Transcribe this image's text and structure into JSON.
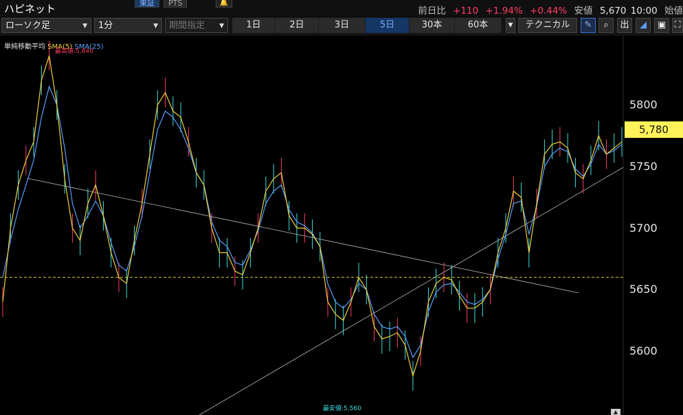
{
  "header": {
    "title": "ハピネット",
    "exchange_tabs": [
      "東証",
      "PTS"
    ],
    "quote": {
      "change_label": "前日比",
      "change": "+110",
      "change_pct": "+1.94%",
      "range_pct": "+0.44%",
      "low_label": "安値",
      "low_value": "5,670",
      "time": "10:00",
      "open_label": "始値"
    }
  },
  "toolbar": {
    "chart_type": "ローソク足",
    "interval": "1分",
    "period_select": "期間指定",
    "ranges": [
      "1日",
      "2日",
      "3日",
      "5日",
      "30本",
      "60本"
    ],
    "active_range": "5日",
    "technical_label": "テクニカル",
    "icons": [
      "pen-icon",
      "zoom-icon",
      "volume-icon",
      "area-chart-icon",
      "save-icon",
      "expand-icon"
    ],
    "icon_glyphs": {
      "volume": "出"
    }
  },
  "chart": {
    "legend": {
      "label": "単純移動平均",
      "sma5": "SMA(5)",
      "sma25": "SMA(25)"
    },
    "current_price": "5,780",
    "high_label": "最高値:5,840",
    "low_label": "最安値:5,560",
    "y_ticks": [
      "5800",
      "5750",
      "5700",
      "5650",
      "5600"
    ],
    "colors": {
      "sma5": "#f2d23a",
      "sma25": "#5aa0ff",
      "up": "#ff3e63",
      "down": "#3fe0e0",
      "reference": "#e6d21a"
    }
  },
  "chart_data": {
    "type": "line",
    "ylim": [
      5555,
      5860
    ],
    "y_ticks": [
      5800,
      5750,
      5700,
      5650,
      5600
    ],
    "reference_line": 5660,
    "series": [
      {
        "name": "SMA(5)",
        "y": [
          5640,
          5700,
          5735,
          5755,
          5770,
          5820,
          5840,
          5800,
          5740,
          5700,
          5690,
          5720,
          5735,
          5710,
          5680,
          5660,
          5655,
          5690,
          5720,
          5760,
          5800,
          5810,
          5795,
          5790,
          5770,
          5745,
          5735,
          5700,
          5680,
          5680,
          5665,
          5662,
          5680,
          5700,
          5730,
          5740,
          5745,
          5710,
          5700,
          5700,
          5695,
          5685,
          5640,
          5630,
          5625,
          5640,
          5660,
          5650,
          5620,
          5610,
          5612,
          5615,
          5605,
          5580,
          5600,
          5640,
          5655,
          5660,
          5658,
          5645,
          5635,
          5635,
          5640,
          5650,
          5680,
          5700,
          5730,
          5725,
          5680,
          5720,
          5760,
          5768,
          5770,
          5765,
          5745,
          5740,
          5755,
          5775,
          5760,
          5765,
          5770
        ]
      },
      {
        "name": "SMA(25)",
        "y": [
          5660,
          5690,
          5715,
          5735,
          5755,
          5790,
          5815,
          5800,
          5765,
          5720,
          5700,
          5710,
          5722,
          5710,
          5688,
          5670,
          5665,
          5685,
          5710,
          5745,
          5780,
          5795,
          5790,
          5780,
          5765,
          5745,
          5735,
          5705,
          5690,
          5685,
          5672,
          5670,
          5682,
          5698,
          5720,
          5730,
          5735,
          5715,
          5705,
          5702,
          5696,
          5685,
          5655,
          5640,
          5635,
          5642,
          5655,
          5650,
          5630,
          5620,
          5618,
          5620,
          5612,
          5595,
          5605,
          5632,
          5648,
          5654,
          5655,
          5648,
          5640,
          5638,
          5642,
          5650,
          5675,
          5695,
          5720,
          5722,
          5695,
          5718,
          5750,
          5760,
          5765,
          5762,
          5748,
          5742,
          5752,
          5768,
          5760,
          5763,
          5768
        ]
      }
    ]
  }
}
